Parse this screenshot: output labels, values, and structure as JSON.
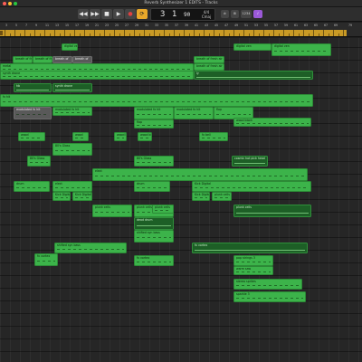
{
  "window": {
    "title": "Reverb Synthesizer 1 EDITS - Tracks",
    "traffic_lights": [
      "#ff5f57",
      "#febc2e",
      "#28c840"
    ]
  },
  "transport": {
    "rewind_icon": "rewind-icon",
    "forward_icon": "fast-forward-icon",
    "stop_icon": "stop-icon",
    "play_icon": "play-icon",
    "record_icon": "record-icon",
    "cycle_icon": "cycle-icon",
    "glyphs": {
      "rewind": "◀◀",
      "forward": "▶▶",
      "stop": "■",
      "play": "▶",
      "record": "●",
      "cycle": "⟳"
    }
  },
  "lcd": {
    "position": "3 1",
    "tempo": "90",
    "signature_top": "4/4",
    "signature_bottom": "Cmaj"
  },
  "toolbar_right": {
    "tools": [
      "⊘",
      "⊞",
      "1234",
      "♪"
    ],
    "accent": "#9b59d8"
  },
  "ruler": {
    "numbers": [
      "3",
      "5",
      "7",
      "9",
      "11",
      "13",
      "15",
      "17",
      "19",
      "21",
      "23",
      "25",
      "27",
      "29",
      "31",
      "33",
      "35",
      "37",
      "39",
      "41",
      "43",
      "45",
      "47",
      "49",
      "51",
      "53",
      "55",
      "57",
      "59",
      "61",
      "63",
      "65",
      "67",
      "69",
      "71",
      "73",
      "75"
    ],
    "end_number": "79",
    "cycle_color": "#c99a25"
  },
  "regions": [
    {
      "label": "digital ven",
      "kind": "g"
    },
    {
      "label": "digital ven",
      "kind": "g"
    },
    {
      "label": "digital ven",
      "kind": "g"
    },
    {
      "label": "breath of fre",
      "kind": "g"
    },
    {
      "label": "breath of fre",
      "kind": "g"
    },
    {
      "label": "breath of",
      "kind": "gray"
    },
    {
      "label": "breath of",
      "kind": "gray"
    },
    {
      "label": "breath of fresh air",
      "kind": "g"
    },
    {
      "label": "breath of fresh air",
      "kind": "g"
    },
    {
      "label": "metal",
      "kind": "g"
    },
    {
      "label": "synth drone",
      "kind": "g"
    },
    {
      "label": "ly",
      "kind": "dark"
    },
    {
      "label": "hb",
      "kind": "dark"
    },
    {
      "label": "synth drone",
      "kind": "dark"
    },
    {
      "label": "fx hit",
      "kind": "g"
    },
    {
      "label": "modulated fx hit",
      "kind": "gray"
    },
    {
      "label": "modulated fx hit",
      "kind": "g"
    },
    {
      "label": "modulated fx hit",
      "kind": "g"
    },
    {
      "label": "modulated fx hit",
      "kind": "g"
    },
    {
      "label": "flap",
      "kind": "g"
    },
    {
      "label": "flap",
      "kind": "g"
    },
    {
      "label": "wood block",
      "kind": "g"
    },
    {
      "label": "wood",
      "kind": "g"
    },
    {
      "label": "wood",
      "kind": "g"
    },
    {
      "label": "wood block",
      "kind": "g"
    },
    {
      "label": "wood block",
      "kind": "g"
    },
    {
      "label": "fx bell",
      "kind": "g"
    },
    {
      "label": "80's Glass",
      "kind": "g"
    },
    {
      "label": "80's Glass",
      "kind": "g"
    },
    {
      "label": "80's Glass",
      "kind": "g"
    },
    {
      "label": "cosmic hot pick head",
      "kind": "dark"
    },
    {
      "label": "elect",
      "kind": "g"
    },
    {
      "label": "drum",
      "kind": "g"
    },
    {
      "label": "elect",
      "kind": "g"
    },
    {
      "label": "drum",
      "kind": "g"
    },
    {
      "label": "Kick Digital",
      "kind": "g"
    },
    {
      "label": "Kick Digital",
      "kind": "g"
    },
    {
      "label": "Kick Digital",
      "kind": "g"
    },
    {
      "label": "Kick Digital",
      "kind": "g"
    },
    {
      "label": "plunk cells",
      "kind": "g"
    },
    {
      "label": "plunk cells",
      "kind": "g"
    },
    {
      "label": "plunk cells",
      "kind": "g"
    },
    {
      "label": "plunk cells",
      "kind": "g"
    },
    {
      "label": "plunk cells",
      "kind": "dark"
    },
    {
      "label": "dead drum",
      "kind": "dark"
    },
    {
      "label": "shifted syn bass",
      "kind": "g"
    },
    {
      "label": "shifted syn bass",
      "kind": "g"
    },
    {
      "label": "fx vortex",
      "kind": "dark"
    },
    {
      "label": "fx vortex",
      "kind": "g"
    },
    {
      "label": "fx vortex",
      "kind": "g"
    },
    {
      "label": "pop strings 3",
      "kind": "g"
    },
    {
      "label": "warm saw",
      "kind": "g"
    },
    {
      "label": "stereo sprites",
      "kind": "g"
    },
    {
      "label": "sparkle 3",
      "kind": "g"
    }
  ]
}
